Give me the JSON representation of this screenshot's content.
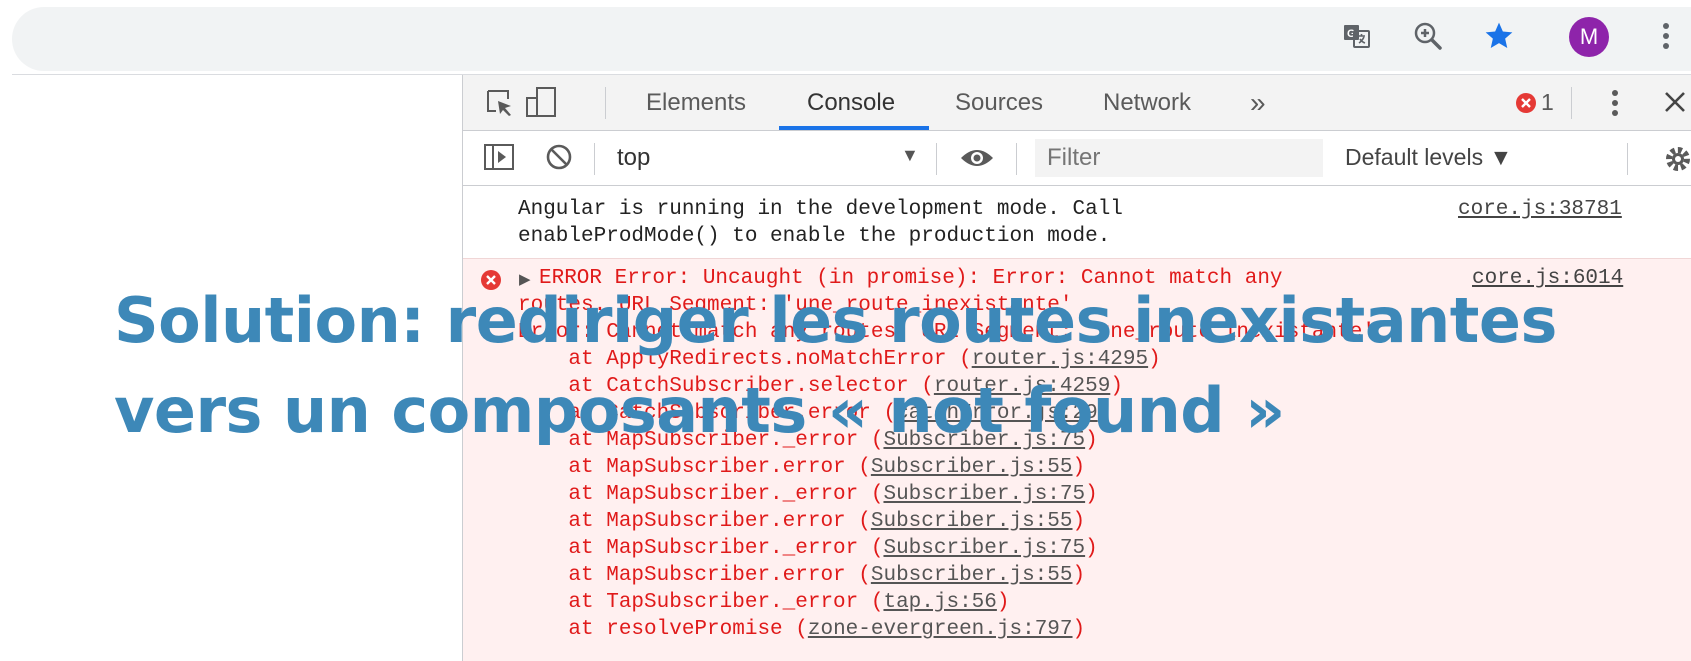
{
  "browser": {
    "icons": [
      "translate-icon",
      "zoom-icon",
      "star-icon",
      "more-vert-icon"
    ],
    "avatar_letter": "M",
    "colors": {
      "avatar": "#8e24aa",
      "star": "#1a73e8"
    }
  },
  "devtools": {
    "tabs": [
      "Elements",
      "Console",
      "Sources",
      "Network"
    ],
    "more_tabs": "»",
    "error_count": "1",
    "context": "top",
    "filter_placeholder": "Filter",
    "levels": "Default levels ▼",
    "logs": {
      "info": {
        "lines": [
          "Angular is running in the development mode. Call",
          "enableProdMode() to enable the production mode."
        ],
        "source": "core.js:38781"
      },
      "error": {
        "expand": "▶",
        "lines": [
          "ERROR Error: Uncaught (in promise): Error: Cannot match any",
          "routes. URL Segment: 'une_route_inexistante'",
          "Error: Cannot match any routes. URL Segment: 'une_route_inexistante'"
        ],
        "source": "core.js:6014",
        "stack": [
          {
            "text": "    at ApplyRedirects.noMatchError (",
            "link": "router.js:4295",
            "end": ")"
          },
          {
            "text": "    at CatchSubscriber.selector (",
            "link": "router.js:4259",
            "end": ")"
          },
          {
            "text": "    at CatchSubscriber.error (",
            "link": "catchError.js:29",
            "end": ")"
          },
          {
            "text": "    at MapSubscriber._error (",
            "link": "Subscriber.js:75",
            "end": ")"
          },
          {
            "text": "    at MapSubscriber.error (",
            "link": "Subscriber.js:55",
            "end": ")"
          },
          {
            "text": "    at MapSubscriber._error (",
            "link": "Subscriber.js:75",
            "end": ")"
          },
          {
            "text": "    at MapSubscriber.error (",
            "link": "Subscriber.js:55",
            "end": ")"
          },
          {
            "text": "    at MapSubscriber._error (",
            "link": "Subscriber.js:75",
            "end": ")"
          },
          {
            "text": "    at MapSubscriber.error (",
            "link": "Subscriber.js:55",
            "end": ")"
          },
          {
            "text": "    at TapSubscriber._error (",
            "link": "tap.js:56",
            "end": ")"
          },
          {
            "text": "    at resolvePromise (",
            "link": "zone-evergreen.js:797",
            "end": ")"
          }
        ]
      }
    }
  },
  "headline": {
    "line1": "Solution: rediriger les routes inexistantes",
    "line2": "vers un composants « not found »",
    "color": "#3d88b8"
  }
}
